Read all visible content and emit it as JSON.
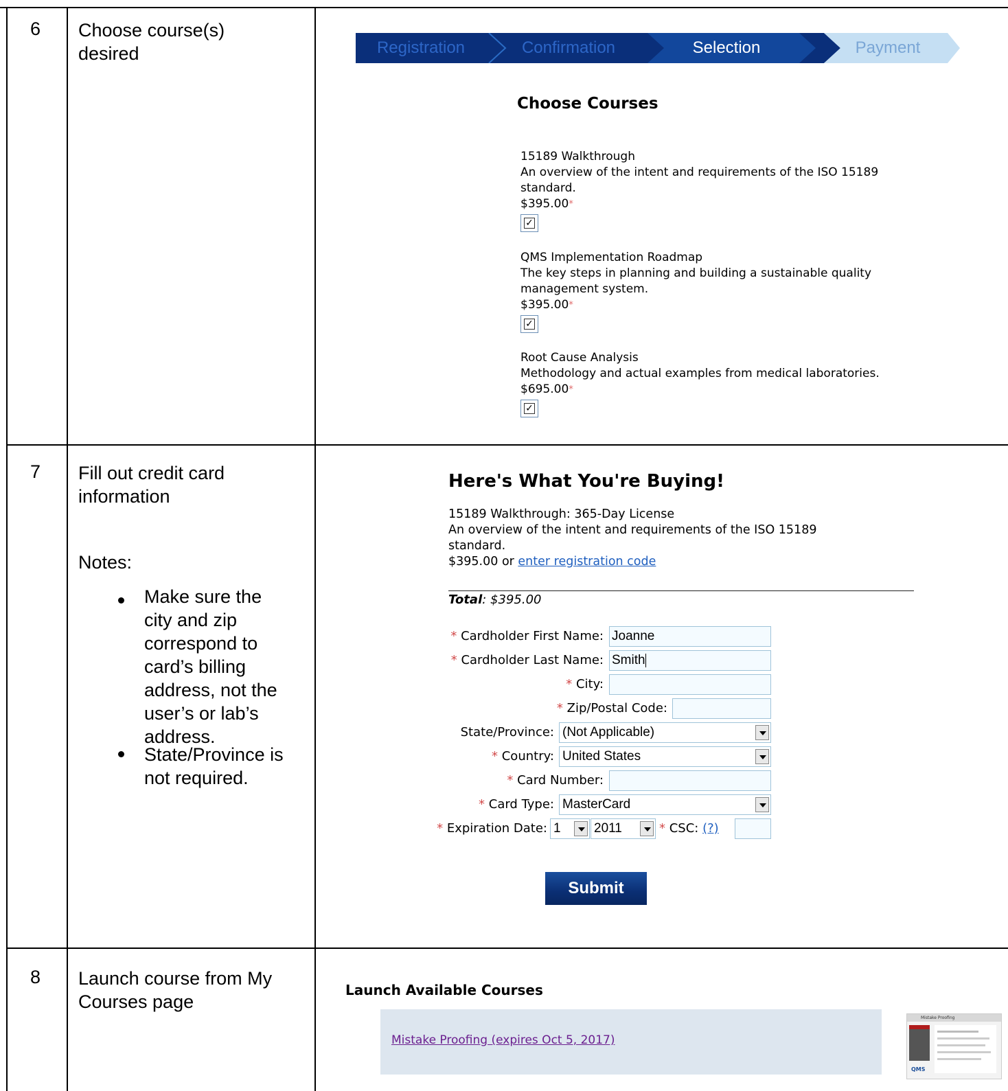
{
  "rows": [
    {
      "num": "6",
      "instruction": [
        "Choose course(s)",
        "desired"
      ]
    },
    {
      "num": "7",
      "instruction": [
        "Fill out credit card",
        "information"
      ],
      "notes_label": "Notes:",
      "bullets": [
        [
          "Make sure the",
          "city and zip",
          "correspond to",
          "card’s billing",
          "address, not the",
          "user’s or lab’s",
          "address."
        ],
        [
          "State/Province is",
          "not required."
        ]
      ]
    },
    {
      "num": "8",
      "instruction": [
        "Launch course from My",
        "Courses page"
      ]
    }
  ],
  "progress": {
    "steps": [
      "Registration",
      "Confirmation",
      "Selection",
      "Payment"
    ]
  },
  "choose_courses": {
    "heading": "Choose Courses",
    "courses": [
      {
        "title": "15189 Walkthrough",
        "desc": [
          "An overview of the intent and requirements of the ISO 15189",
          "standard."
        ],
        "price": "$395.00",
        "checked": true
      },
      {
        "title": "QMS Implementation Roadmap",
        "desc": [
          "The key steps in planning and building a sustainable quality",
          "management system."
        ],
        "price": "$395.00",
        "checked": true
      },
      {
        "title": "Root Cause Analysis",
        "desc": [
          "Methodology and actual examples from medical laboratories."
        ],
        "price": "$695.00",
        "checked": true
      }
    ]
  },
  "buying": {
    "heading": "Here's What You're Buying!",
    "item_title": "15189 Walkthrough: 365-Day License",
    "item_desc": [
      "An overview of the intent and requirements of the ISO 15189",
      "standard."
    ],
    "price": "$395.00",
    "or": " or ",
    "reg_link": "enter registration code",
    "total_label": "Total",
    "total_value": ": $395.00"
  },
  "form": {
    "first_name_label": "Cardholder First Name:",
    "first_name_value": "Joanne",
    "last_name_label": "Cardholder Last Name:",
    "last_name_value": "Smith",
    "city_label": "City:",
    "zip_label": "Zip/Postal Code:",
    "state_label": "State/Province:",
    "state_value": "(Not Applicable)",
    "country_label": "Country:",
    "country_value": "United States",
    "card_number_label": "Card Number:",
    "card_type_label": "Card Type:",
    "card_type_value": "MasterCard",
    "exp_label": "Expiration Date:",
    "exp_month": "1",
    "exp_year": "2011",
    "csc_label": "CSC:",
    "csc_help": "(?)",
    "submit": "Submit",
    "required_mark": "*"
  },
  "launch": {
    "heading": "Launch Available Courses",
    "course_link": "Mistake Proofing (expires Oct 5, 2017)",
    "thumb_title": "Mistake Proofing",
    "thumb_logo": "QMS"
  },
  "colors": {
    "progress_dark": "#0a2f7a",
    "progress_mid": "#12479c",
    "progress_light": "#c5dff3",
    "submit_bg": "#0b2f74",
    "launch_bg": "#dde6ef"
  }
}
